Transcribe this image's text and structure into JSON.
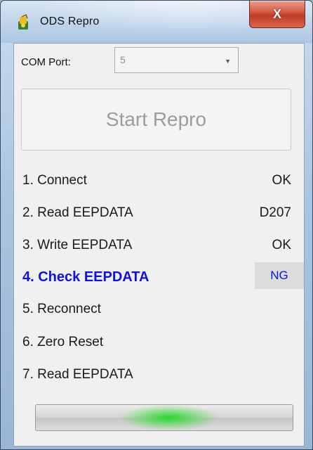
{
  "window": {
    "title": "ODS Repro",
    "close_label": "X"
  },
  "com_port": {
    "label": "COM Port:",
    "value": "5"
  },
  "start_button": {
    "label": "Start Repro"
  },
  "steps": [
    {
      "label": "1. Connect",
      "status": "OK"
    },
    {
      "label": "2. Read EEPDATA",
      "status": "D207"
    },
    {
      "label": "3. Write EEPDATA",
      "status": "OK"
    },
    {
      "label": "4. Check EEPDATA",
      "status": "NG"
    },
    {
      "label": "5. Reconnect",
      "status": ""
    },
    {
      "label": "6. Zero Reset",
      "status": ""
    },
    {
      "label": "7. Read EEPDATA",
      "status": ""
    }
  ],
  "active_step_color": "#1111dd",
  "progress": {
    "style": "marquee",
    "glow_color": "#1ed728"
  },
  "icons": {
    "app": "app-icon",
    "close": "close-icon",
    "dropdown": "chevron-down-icon"
  }
}
